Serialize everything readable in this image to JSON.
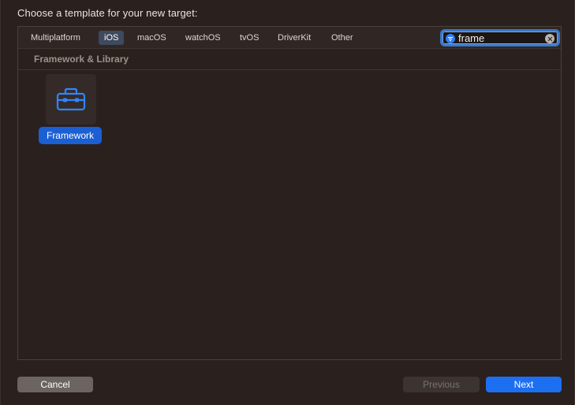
{
  "dialog": {
    "heading": "Choose a template for your new target:"
  },
  "tabs": [
    {
      "label": "Multiplatform",
      "selected": false
    },
    {
      "label": "iOS",
      "selected": true
    },
    {
      "label": "macOS",
      "selected": false
    },
    {
      "label": "watchOS",
      "selected": false
    },
    {
      "label": "tvOS",
      "selected": false
    },
    {
      "label": "DriverKit",
      "selected": false
    },
    {
      "label": "Other",
      "selected": false
    }
  ],
  "search": {
    "value": "frame",
    "icon": "filter-icon",
    "clear_icon": "clear-icon"
  },
  "section": {
    "title": "Framework & Library"
  },
  "templates": [
    {
      "label": "Framework",
      "icon": "toolbox-icon",
      "selected": true
    }
  ],
  "buttons": {
    "cancel": "Cancel",
    "previous": "Previous",
    "next": "Next"
  },
  "colors": {
    "accent": "#1d6ff2",
    "selection": "#1b5fd4",
    "background": "#2a201d"
  }
}
